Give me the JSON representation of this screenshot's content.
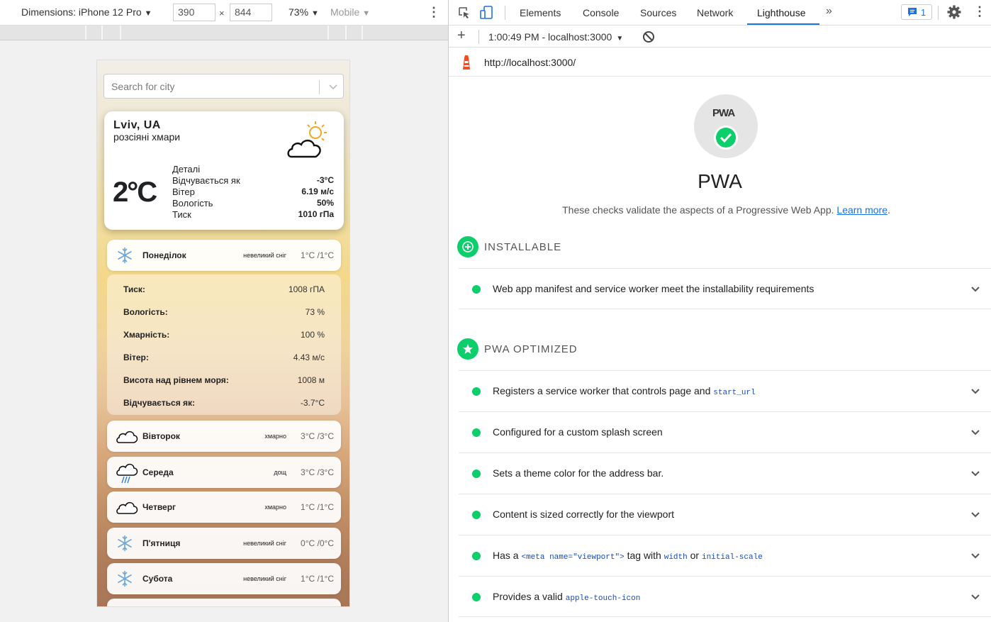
{
  "device_toolbar": {
    "dimensions_label": "Dimensions: iPhone 12 Pro",
    "width": "390",
    "height": "844",
    "times": "×",
    "zoom": "73%",
    "mode": "Mobile"
  },
  "weather_app": {
    "search_placeholder": "Search for city",
    "current": {
      "city": "Lviv, UA",
      "description": "розсіяні хмари",
      "temperature": "2°C",
      "details_title": "Деталі",
      "details": [
        {
          "label": "Відчувається як",
          "value": "-3°C"
        },
        {
          "label": "Вітер",
          "value": "6.19 м/с"
        },
        {
          "label": "Вологість",
          "value": "50%"
        },
        {
          "label": "Тиск",
          "value": "1010 гПа"
        }
      ]
    },
    "days": [
      {
        "name": "Понеділок",
        "condition": "невеликий сніг",
        "temp": "1°C /1°C",
        "icon": "snowflake-icon"
      },
      {
        "name": "Вівторок",
        "condition": "хмарно",
        "temp": "3°C /3°C",
        "icon": "cloud-icon"
      },
      {
        "name": "Середа",
        "condition": "дощ",
        "temp": "3°C /3°C",
        "icon": "rain-icon"
      },
      {
        "name": "Четверг",
        "condition": "хмарно",
        "temp": "1°C /1°C",
        "icon": "cloud-icon"
      },
      {
        "name": "П'ятниця",
        "condition": "невеликий сніг",
        "temp": "0°C /0°C",
        "icon": "snowflake-icon"
      },
      {
        "name": "Субота",
        "condition": "невеликий сніг",
        "temp": "1°C /1°C",
        "icon": "snowflake-icon"
      }
    ],
    "expanded_details": [
      {
        "label": "Тиск:",
        "value": "1008 гПА"
      },
      {
        "label": "Вологість:",
        "value": "73 %"
      },
      {
        "label": "Хмарність:",
        "value": "100 %"
      },
      {
        "label": "Вітер:",
        "value": "4.43 м/с"
      },
      {
        "label": "Висота над рівнем моря:",
        "value": "1008 м"
      },
      {
        "label": "Відчувається як:",
        "value": "-3.7°C"
      }
    ]
  },
  "devtools": {
    "tabs": [
      "Elements",
      "Console",
      "Sources",
      "Network",
      "Lighthouse"
    ],
    "active_tab": "Lighthouse",
    "issues_count": "1",
    "report_selector": "1:00:49 PM - localhost:3000",
    "url": "http://localhost:3000/",
    "category_logo": "PWA",
    "category_title": "PWA",
    "category_description": "These checks validate the aspects of a Progressive Web App.",
    "learn_more": "Learn more",
    "learn_more_suffix": ".",
    "pass_color": "#0cce6b",
    "groups": [
      {
        "title": "INSTALLABLE",
        "audits": [
          {
            "text": "Web app manifest and service worker meet the installability requirements"
          }
        ]
      },
      {
        "title": "PWA OPTIMIZED",
        "audits": [
          {
            "text": "Registers a service worker that controls page and",
            "code": "start_url"
          },
          {
            "text": "Configured for a custom splash screen"
          },
          {
            "text": "Sets a theme color for the address bar."
          },
          {
            "text": "Content is sized correctly for the viewport"
          },
          {
            "text": "Has a",
            "code": "<meta name=\"viewport\">",
            "text2": "tag with",
            "code2": "width",
            "text3": "or",
            "code3": "initial-scale"
          },
          {
            "text": "Provides a valid",
            "code": "apple-touch-icon"
          }
        ]
      }
    ]
  }
}
